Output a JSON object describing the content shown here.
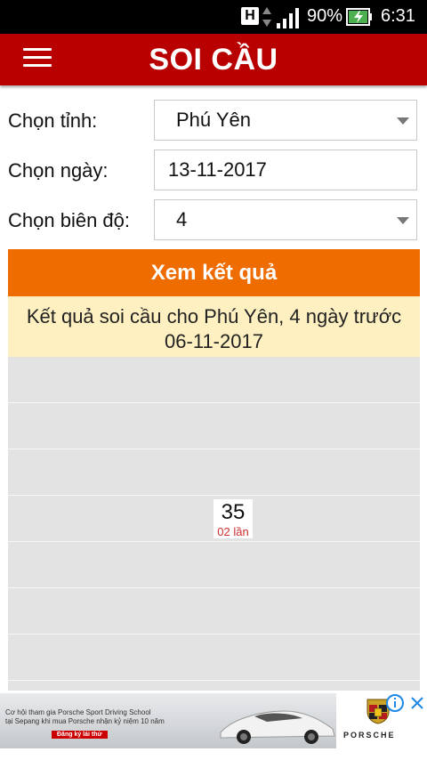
{
  "status_bar": {
    "network_letter": "H",
    "battery_percent": "90%",
    "time": "6:31",
    "battery_charging": true
  },
  "toolbar": {
    "title": "SOI CẦU",
    "menu_icon": "hamburger-menu-icon",
    "color": "#b80000"
  },
  "form": {
    "province_label": "Chọn tỉnh:",
    "province_value": "Phú Yên",
    "date_label": "Chọn ngày:",
    "date_value": "13-11-2017",
    "range_label": "Chọn biên độ:",
    "range_value": "4"
  },
  "view_button": {
    "label": "Xem kết quả",
    "color": "#ef6c00"
  },
  "result": {
    "line1": "Kết quả soi cầu cho Phú Yên, 4 ngày trước",
    "line2": "06-11-2017",
    "highlight_number": "35",
    "highlight_count": "02 lần"
  },
  "ad": {
    "line1": "Cơ hội tham gia Porsche Sport Driving School",
    "line2": "tại Sepang khi mua Porsche nhận kỷ niệm 10 năm",
    "cta": "Đăng ký lái thử",
    "brand": "PORSCHE"
  }
}
